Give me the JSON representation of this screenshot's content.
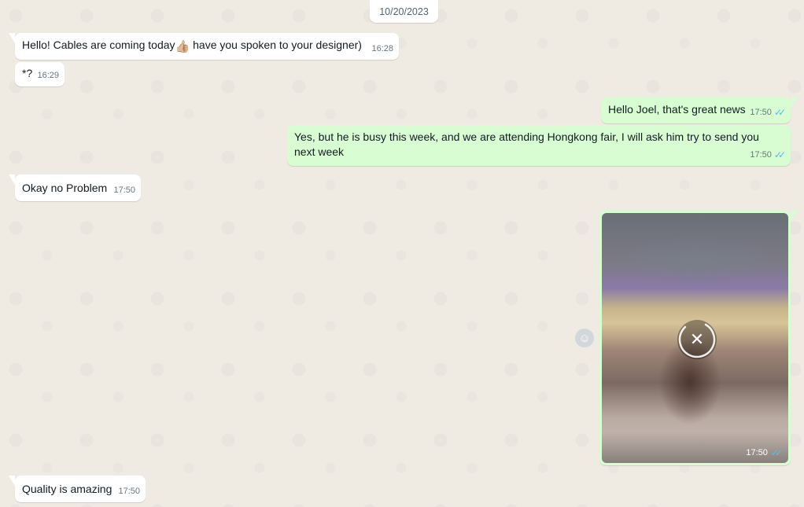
{
  "date_separator": "10/20/2023",
  "messages": [
    {
      "text": "Hello! Cables are coming today",
      "emoji": "👍🏼",
      "text_after": " have you spoken to your designer)",
      "time": "16:28"
    },
    {
      "text": "*?",
      "time": "16:29"
    },
    {
      "text": "Hello Joel, that's great news",
      "time": "17:50"
    },
    {
      "text": "Yes, but he is busy this week, and we are attending Hongkong fair, I will ask him try to send you next week",
      "time": "17:50"
    },
    {
      "text": "Okay no Problem",
      "time": "17:50"
    },
    {
      "time": "17:50"
    },
    {
      "text": "Quality is amazing",
      "time": "17:50"
    }
  ],
  "icons": {
    "read_ticks": "✓✓",
    "cancel": "✕",
    "react": "☺"
  },
  "colors": {
    "incoming": "#ffffff",
    "outgoing": "#d9fdd3",
    "read_ticks": "#53bdeb",
    "wallpaper": "#efeae2"
  }
}
